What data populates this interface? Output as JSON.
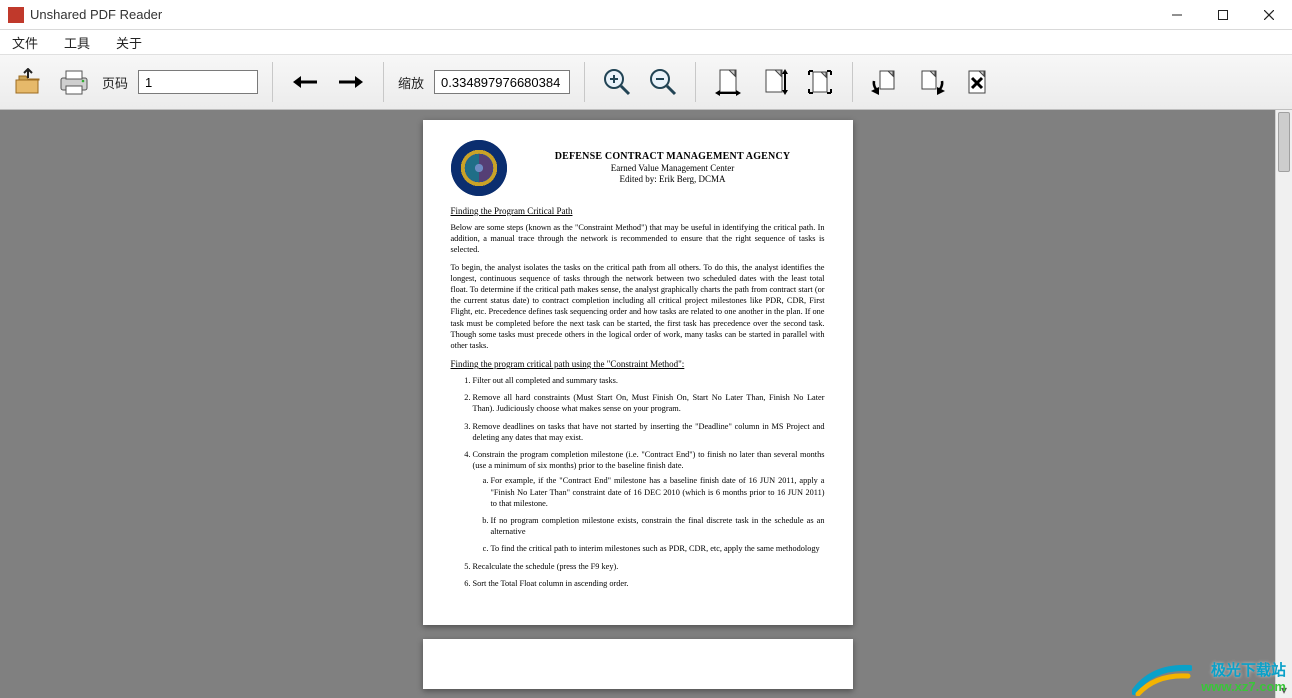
{
  "window": {
    "title": "Unshared PDF Reader"
  },
  "menu": {
    "file": "文件",
    "tools": "工具",
    "about": "关于"
  },
  "toolbar": {
    "page_label": "页码",
    "page_value": "1",
    "zoom_label": "缩放",
    "zoom_value": "0.334897976680384"
  },
  "icons": {
    "open": "open-file-icon",
    "print": "printer-icon",
    "prev": "previous-page-icon",
    "next": "next-page-icon",
    "zoom_in": "zoom-in-icon",
    "zoom_out": "zoom-out-icon",
    "fit_width": "fit-width-icon",
    "fit_height": "fit-height-icon",
    "full_screen": "full-screen-icon",
    "rotate_ccw": "rotate-ccw-icon",
    "rotate_cw": "rotate-cw-icon",
    "close_doc": "close-document-icon"
  },
  "document": {
    "header": {
      "title": "DEFENSE CONTRACT MANAGEMENT AGENCY",
      "subtitle": "Earned Value Management Center",
      "edited_by": "Edited by: Erik Berg, DCMA"
    },
    "section1_title": "Finding the Program Critical Path",
    "para1": "Below are some steps (known as the \"Constraint Method\") that may be useful in identifying the critical path. In addition, a manual trace through the network is recommended to ensure that the right sequence of tasks is selected.",
    "para2": "To begin, the analyst isolates the tasks on the critical path from all others. To do this, the analyst identifies the longest, continuous sequence of tasks through the network between two scheduled dates with the least total float. To determine if the critical path makes sense, the analyst graphically charts the path from contract start (or the current status date) to contract completion including all critical project milestones like PDR, CDR, First Flight, etc. Precedence defines task sequencing order and how tasks are related to one another in the plan. If one task must be completed before the next task can be started, the first task has precedence over the second task. Though some tasks must precede others in the logical order of work, many tasks can be started in parallel with other tasks.",
    "section2_title": "Finding the program critical path using the \"Constraint Method\":",
    "steps": [
      "Filter out all completed and summary tasks.",
      "Remove all hard constraints (Must Start On, Must Finish On, Start No Later Than, Finish No Later Than). Judiciously choose what makes sense on your program.",
      "Remove deadlines on tasks that have not started by inserting the \"Deadline\" column in MS Project and deleting any dates that may exist.",
      "Constrain the program completion milestone (i.e. \"Contract End\") to finish no later than several months (use a minimum of six months) prior to the baseline finish date.",
      "Recalculate the schedule (press the F9 key).",
      "Sort the Total Float column in ascending order."
    ],
    "substeps": [
      "For example, if the \"Contract End\" milestone has a baseline finish date of 16 JUN 2011, apply a \"Finish No Later Than\" constraint date of 16 DEC 2010 (which is 6 months prior to 16 JUN 2011) to that milestone.",
      "If no program completion milestone exists, constrain the final discrete task in the schedule as an alternative",
      "To find the critical path to interim milestones such as PDR, CDR, etc, apply the same methodology"
    ]
  },
  "watermark": {
    "line1": "极光下载站",
    "line2": "www.xz7.com"
  }
}
